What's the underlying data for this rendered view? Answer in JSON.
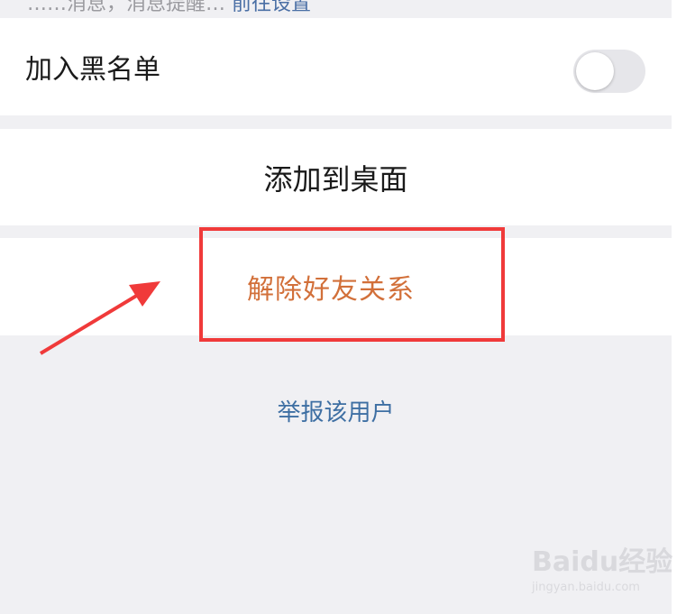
{
  "top_note": {
    "text": "……消息，消息提醒…",
    "link": "前往设置"
  },
  "blacklist": {
    "label": "加入黑名单",
    "enabled": false
  },
  "desktop": {
    "label": "添加到桌面"
  },
  "unfriend": {
    "label": "解除好友关系"
  },
  "report": {
    "label": "举报该用户"
  },
  "watermark": {
    "brand": "Baidu经验",
    "domain": "jingyan.baidu.com"
  },
  "colors": {
    "background": "#f0f0f3",
    "card": "#ffffff",
    "destructive": "#d2703a",
    "link": "#3e6fa3",
    "annotation": "#f03a3a"
  }
}
